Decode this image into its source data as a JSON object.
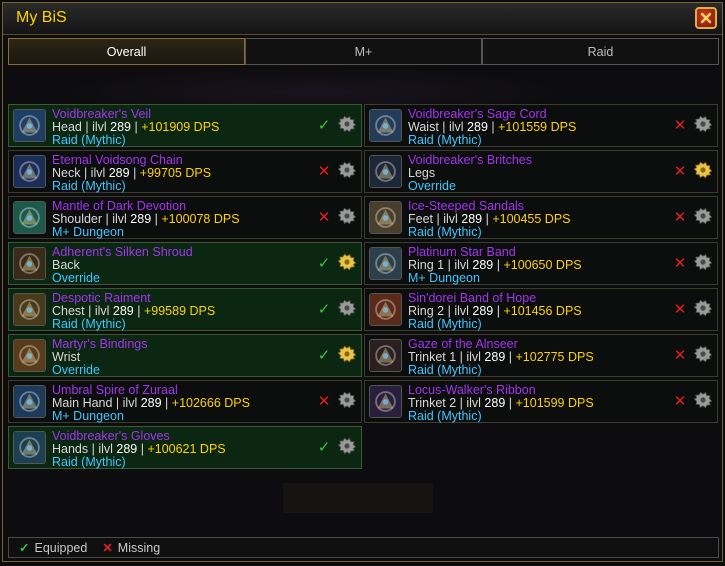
{
  "window": {
    "title": "My BiS"
  },
  "tabs": [
    {
      "label": "Overall",
      "active": true
    },
    {
      "label": "M+",
      "active": false
    },
    {
      "label": "Raid",
      "active": false
    }
  ],
  "left_items": [
    {
      "name": "Voidbreaker's Veil",
      "slot": "Head",
      "ilvl": "289",
      "dps": "+101909 DPS",
      "source": "Raid (Mythic)",
      "equipped": true,
      "icon": "head-icon",
      "color": "#1e3f63"
    },
    {
      "name": "Eternal Voidsong Chain",
      "slot": "Neck",
      "ilvl": "289",
      "dps": "+99705 DPS",
      "source": "Raid (Mythic)",
      "equipped": false,
      "icon": "neck-icon",
      "color": "#1b2e5a"
    },
    {
      "name": "Mantle of Dark Devotion",
      "slot": "Shoulder",
      "ilvl": "289",
      "dps": "+100078 DPS",
      "source": "M+ Dungeon",
      "equipped": false,
      "icon": "shoulder-icon",
      "color": "#1d5a4c"
    },
    {
      "name": "Adherent's Silken Shroud",
      "slot": "Back",
      "ilvl": "",
      "dps": "",
      "source": "Override",
      "equipped": true,
      "icon": "back-icon",
      "color": "#3a2a1a"
    },
    {
      "name": "Despotic Raiment",
      "slot": "Chest",
      "ilvl": "289",
      "dps": "+99589 DPS",
      "source": "Raid (Mythic)",
      "equipped": true,
      "icon": "chest-icon",
      "color": "#4a3a1c"
    },
    {
      "name": "Martyr's Bindings",
      "slot": "Wrist",
      "ilvl": "",
      "dps": "",
      "source": "Override",
      "equipped": true,
      "icon": "wrist-icon",
      "color": "#5a3c1a"
    },
    {
      "name": "Umbral Spire of Zuraal",
      "slot": "Main Hand",
      "ilvl": "289",
      "dps": "+102666 DPS",
      "source": "M+ Dungeon",
      "equipped": false,
      "icon": "staff-icon",
      "color": "#1c3a5a"
    },
    {
      "name": "Voidbreaker's Gloves",
      "slot": "Hands",
      "ilvl": "289",
      "dps": "+100621 DPS",
      "source": "Raid (Mythic)",
      "equipped": true,
      "icon": "hands-icon",
      "color": "#1d3f52"
    }
  ],
  "right_items": [
    {
      "name": "Voidbreaker's Sage Cord",
      "slot": "Waist",
      "ilvl": "289",
      "dps": "+101559 DPS",
      "source": "Raid (Mythic)",
      "equipped": false,
      "icon": "waist-icon",
      "color": "#243c5a"
    },
    {
      "name": "Voidbreaker's Britches",
      "slot": "Legs",
      "ilvl": "",
      "dps": "",
      "source": "Override",
      "equipped": false,
      "icon": "legs-icon",
      "color": "#1c2738"
    },
    {
      "name": "Ice-Steeped Sandals",
      "slot": "Feet",
      "ilvl": "289",
      "dps": "+100455 DPS",
      "source": "Raid (Mythic)",
      "equipped": false,
      "icon": "feet-icon",
      "color": "#4a3f2c"
    },
    {
      "name": "Platinum Star Band",
      "slot": "Ring 1",
      "ilvl": "289",
      "dps": "+100650 DPS",
      "source": "M+ Dungeon",
      "equipped": false,
      "icon": "ring-icon",
      "color": "#2d3f4a"
    },
    {
      "name": "Sin'dorei Band of Hope",
      "slot": "Ring 2",
      "ilvl": "289",
      "dps": "+101456 DPS",
      "source": "Raid (Mythic)",
      "equipped": false,
      "icon": "ring-icon",
      "color": "#5a2a1a"
    },
    {
      "name": "Gaze of the Alnseer",
      "slot": "Trinket 1",
      "ilvl": "289",
      "dps": "+102775 DPS",
      "source": "Raid (Mythic)",
      "equipped": false,
      "icon": "trinket-icon",
      "color": "#2a2020"
    },
    {
      "name": "Locus-Walker's Ribbon",
      "slot": "Trinket 2",
      "ilvl": "289",
      "dps": "+101599 DPS",
      "source": "Raid (Mythic)",
      "equipped": false,
      "icon": "trinket-icon",
      "color": "#2a1f3a"
    }
  ],
  "legend": {
    "equipped_label": "Equipped",
    "missing_label": "Missing",
    "equipped_symbol": "✓",
    "missing_symbol": "✕"
  },
  "colors": {
    "epic": "#a335ee",
    "source": "#3fc8ff",
    "dps": "#ffd200",
    "equipped_bg": "#0b2711",
    "check": "#3ec13b",
    "cross": "#e02020"
  }
}
